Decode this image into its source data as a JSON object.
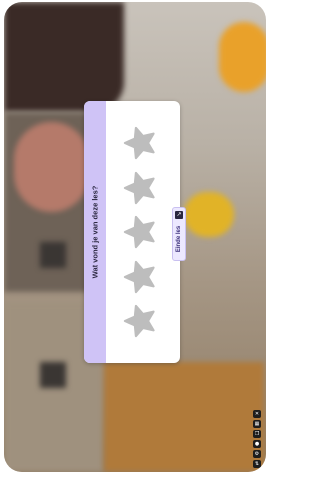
{
  "feedback": {
    "question": "Wat vond je van deze les?",
    "rating": {
      "value": 0,
      "max": 5
    },
    "star_color": "#bdbdbd",
    "accent": "#cfc3f6"
  },
  "end_lesson": {
    "label": "Einde les",
    "icon": "exit-icon"
  },
  "controls": {
    "icons": [
      "close-icon",
      "grid-icon",
      "copy-icon",
      "record-icon",
      "settings-icon",
      "expand-icon"
    ]
  }
}
